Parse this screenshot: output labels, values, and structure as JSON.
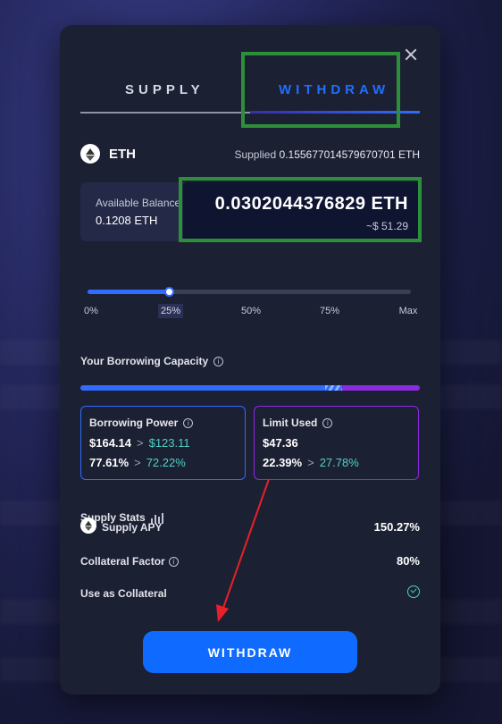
{
  "tabs": {
    "supply": "SUPPLY",
    "withdraw": "WITHDRAW"
  },
  "asset": {
    "name": "ETH",
    "supplied_label": "Supplied",
    "supplied_value": "0.155677014579670701 ETH"
  },
  "balance": {
    "label": "Available Balance",
    "value": "0.1208 ETH",
    "amount": "0.0302044376829 ETH",
    "usd": "~$ 51.29"
  },
  "slider": {
    "ticks": [
      "0%",
      "25%",
      "50%",
      "75%",
      "Max"
    ],
    "selected_percent": 25
  },
  "capacity": {
    "title": "Your Borrowing Capacity",
    "blue_fraction": 0.72,
    "stripe_fraction": 0.05,
    "purple_fraction": 0.23
  },
  "borrowing_power": {
    "title": "Borrowing Power",
    "value_from": "$164.14",
    "value_to": "$123.11",
    "pct_from": "77.61%",
    "pct_to": "72.22%"
  },
  "limit_used": {
    "title": "Limit Used",
    "value": "$47.36",
    "pct_from": "22.39%",
    "pct_to": "27.78%"
  },
  "stats": {
    "title": "Supply Stats",
    "supply_apy_label": "Supply APY",
    "supply_apy_value": "150.27%",
    "collateral_factor_label": "Collateral Factor",
    "collateral_factor_value": "80%",
    "use_collateral_label": "Use as Collateral"
  },
  "button": {
    "label": "WITHDRAW"
  },
  "colors": {
    "accent": "#2f6cff",
    "purple": "#8a2be2",
    "teal": "#4fd1c5",
    "annotation_green": "#2e8f3a",
    "annotation_red": "#e8202a"
  },
  "icons": [
    "close-icon",
    "eth-icon",
    "info-icon",
    "bar-chart-icon",
    "check-circle-icon",
    "arrow-right-icon"
  ]
}
